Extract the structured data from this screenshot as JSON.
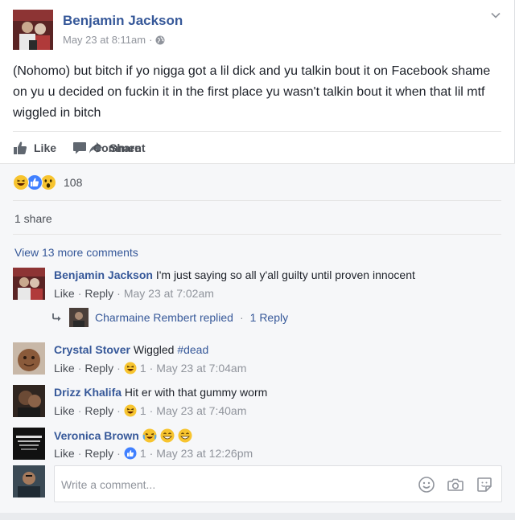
{
  "post": {
    "author": "Benjamin Jackson",
    "timestamp": "May 23 at 8:11am",
    "separator": "·",
    "text": "(Nohomo) but bitch if yo nigga got a lil dick and yu talkin bout it on Facebook shame on yu u decided on fuckin it in the first place yu wasn't talkin bout it when that lil mtf wiggled in bitch"
  },
  "actions": {
    "like": "Like",
    "comment": "Comment",
    "share": "Share"
  },
  "reactions": {
    "icons": [
      "haha-icon",
      "like-icon",
      "wow-icon"
    ],
    "count": "108"
  },
  "shares": "1 share",
  "view_more": "View 13 more comments",
  "comments": [
    {
      "name": "Benjamin Jackson",
      "text": "I'm just saying so all y'all guilty until proven innocent",
      "like": "Like",
      "reply": "Reply",
      "time": "May 23 at 7:02am"
    },
    {
      "name": "Crystal Stover",
      "text": "Wiggled",
      "hashtag": "#dead",
      "like": "Like",
      "reply": "Reply",
      "reaction_count": "1",
      "time": "May 23 at 7:04am"
    },
    {
      "name": "Drizz Khalifa",
      "text": "Hit er with that gummy worm",
      "like": "Like",
      "reply": "Reply",
      "reaction_count": "1",
      "time": "May 23 at 7:40am"
    },
    {
      "name": "Veronica Brown",
      "text": "",
      "like": "Like",
      "reply": "Reply",
      "reaction_count": "1",
      "time": "May 23 at 12:26pm"
    }
  ],
  "reply_thread": {
    "text": "Charmaine Rembert replied",
    "count": "1 Reply"
  },
  "compose": {
    "placeholder": "Write a comment..."
  },
  "colors": {
    "link": "#365899",
    "meta": "#90949c",
    "background": "#e9ebee",
    "like_blue": "#4080ff",
    "emoji_yellow": "#f7c42f"
  }
}
